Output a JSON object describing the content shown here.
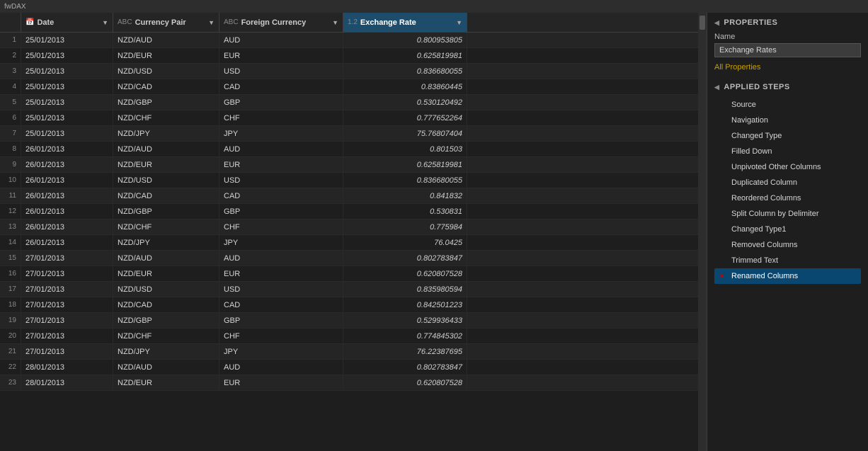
{
  "titleBar": {
    "label": "fwDAX"
  },
  "columns": [
    {
      "id": "date",
      "label": "Date",
      "typeIcon": "📅",
      "icon": "▼",
      "class": "col-header-date"
    },
    {
      "id": "pair",
      "label": "Currency Pair",
      "typeIcon": "ABC",
      "icon": "▼",
      "class": "col-header-pair"
    },
    {
      "id": "foreign",
      "label": "Foreign Currency",
      "typeIcon": "ABC",
      "icon": "▼",
      "class": "col-header-foreign"
    },
    {
      "id": "rate",
      "label": "Exchange Rate",
      "typeIcon": "1.2",
      "icon": "▼",
      "class": "col-header-rate"
    }
  ],
  "rows": [
    {
      "num": 1,
      "date": "25/01/2013",
      "pair": "NZD/AUD",
      "foreign": "AUD",
      "rate": "0.800953805"
    },
    {
      "num": 2,
      "date": "25/01/2013",
      "pair": "NZD/EUR",
      "foreign": "EUR",
      "rate": "0.625819981"
    },
    {
      "num": 3,
      "date": "25/01/2013",
      "pair": "NZD/USD",
      "foreign": "USD",
      "rate": "0.836680055"
    },
    {
      "num": 4,
      "date": "25/01/2013",
      "pair": "NZD/CAD",
      "foreign": "CAD",
      "rate": "0.83860445"
    },
    {
      "num": 5,
      "date": "25/01/2013",
      "pair": "NZD/GBP",
      "foreign": "GBP",
      "rate": "0.530120492"
    },
    {
      "num": 6,
      "date": "25/01/2013",
      "pair": "NZD/CHF",
      "foreign": "CHF",
      "rate": "0.777652264"
    },
    {
      "num": 7,
      "date": "25/01/2013",
      "pair": "NZD/JPY",
      "foreign": "JPY",
      "rate": "75.76807404"
    },
    {
      "num": 8,
      "date": "26/01/2013",
      "pair": "NZD/AUD",
      "foreign": "AUD",
      "rate": "0.801503"
    },
    {
      "num": 9,
      "date": "26/01/2013",
      "pair": "NZD/EUR",
      "foreign": "EUR",
      "rate": "0.625819981"
    },
    {
      "num": 10,
      "date": "26/01/2013",
      "pair": "NZD/USD",
      "foreign": "USD",
      "rate": "0.836680055"
    },
    {
      "num": 11,
      "date": "26/01/2013",
      "pair": "NZD/CAD",
      "foreign": "CAD",
      "rate": "0.841832"
    },
    {
      "num": 12,
      "date": "26/01/2013",
      "pair": "NZD/GBP",
      "foreign": "GBP",
      "rate": "0.530831"
    },
    {
      "num": 13,
      "date": "26/01/2013",
      "pair": "NZD/CHF",
      "foreign": "CHF",
      "rate": "0.775984"
    },
    {
      "num": 14,
      "date": "26/01/2013",
      "pair": "NZD/JPY",
      "foreign": "JPY",
      "rate": "76.0425"
    },
    {
      "num": 15,
      "date": "27/01/2013",
      "pair": "NZD/AUD",
      "foreign": "AUD",
      "rate": "0.802783847"
    },
    {
      "num": 16,
      "date": "27/01/2013",
      "pair": "NZD/EUR",
      "foreign": "EUR",
      "rate": "0.620807528"
    },
    {
      "num": 17,
      "date": "27/01/2013",
      "pair": "NZD/USD",
      "foreign": "USD",
      "rate": "0.835980594"
    },
    {
      "num": 18,
      "date": "27/01/2013",
      "pair": "NZD/CAD",
      "foreign": "CAD",
      "rate": "0.842501223"
    },
    {
      "num": 19,
      "date": "27/01/2013",
      "pair": "NZD/GBP",
      "foreign": "GBP",
      "rate": "0.529936433"
    },
    {
      "num": 20,
      "date": "27/01/2013",
      "pair": "NZD/CHF",
      "foreign": "CHF",
      "rate": "0.774845302"
    },
    {
      "num": 21,
      "date": "27/01/2013",
      "pair": "NZD/JPY",
      "foreign": "JPY",
      "rate": "76.22387695"
    },
    {
      "num": 22,
      "date": "28/01/2013",
      "pair": "NZD/AUD",
      "foreign": "AUD",
      "rate": "0.802783847"
    },
    {
      "num": 23,
      "date": "28/01/2013",
      "pair": "NZD/EUR",
      "foreign": "EUR",
      "rate": "0.620807528"
    }
  ],
  "sidebar": {
    "properties": {
      "sectionLabel": "PROPERTIES",
      "nameLabel": "Name",
      "nameValue": "Exchange Rates",
      "allPropertiesLabel": "All Properties"
    },
    "appliedSteps": {
      "sectionLabel": "APPLIED STEPS",
      "steps": [
        {
          "id": "source",
          "label": "Source",
          "hasIcon": false
        },
        {
          "id": "navigation",
          "label": "Navigation",
          "hasIcon": false
        },
        {
          "id": "changed-type",
          "label": "Changed Type",
          "hasIcon": false
        },
        {
          "id": "filled-down",
          "label": "Filled Down",
          "hasIcon": false
        },
        {
          "id": "unpivoted",
          "label": "Unpivoted Other Columns",
          "hasIcon": false
        },
        {
          "id": "duplicated-col",
          "label": "Duplicated Column",
          "hasIcon": false
        },
        {
          "id": "reordered-cols",
          "label": "Reordered Columns",
          "hasIcon": false
        },
        {
          "id": "split-col",
          "label": "Split Column by Delimiter",
          "hasIcon": false
        },
        {
          "id": "changed-type1",
          "label": "Changed Type1",
          "hasIcon": false
        },
        {
          "id": "removed-cols",
          "label": "Removed Columns",
          "hasIcon": false
        },
        {
          "id": "trimmed-text",
          "label": "Trimmed Text",
          "hasIcon": false
        },
        {
          "id": "renamed-cols",
          "label": "Renamed Columns",
          "hasIcon": true,
          "active": true
        }
      ]
    }
  }
}
